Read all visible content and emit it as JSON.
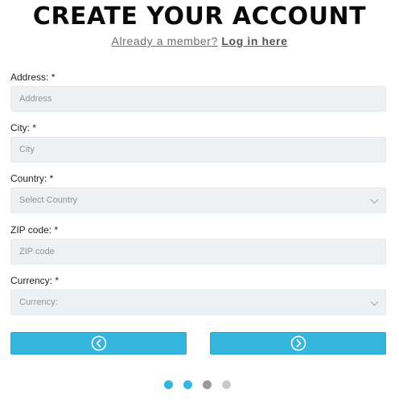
{
  "header": {
    "title": "CREATE YOUR ACCOUNT",
    "member_text": "Already a member?",
    "login_link": "Log in here"
  },
  "fields": {
    "address": {
      "label": "Address: *",
      "placeholder": "Address"
    },
    "city": {
      "label": "City: *",
      "placeholder": "City"
    },
    "country": {
      "label": "Country: *",
      "placeholder": "Select Country"
    },
    "zip": {
      "label": "ZIP code: *",
      "placeholder": "ZIP code"
    },
    "currency": {
      "label": "Currency: *",
      "placeholder": "Currency:"
    }
  },
  "nav": {
    "prev_icon": "chevron-left-circle-icon",
    "next_icon": "chevron-right-circle-icon"
  },
  "pagination": {
    "total": 4,
    "dot_colors": [
      "#35b6df",
      "#35b6df",
      "#999999",
      "#cccccc"
    ]
  },
  "colors": {
    "accent": "#35b6df",
    "field_bg": "#eef1f4"
  }
}
